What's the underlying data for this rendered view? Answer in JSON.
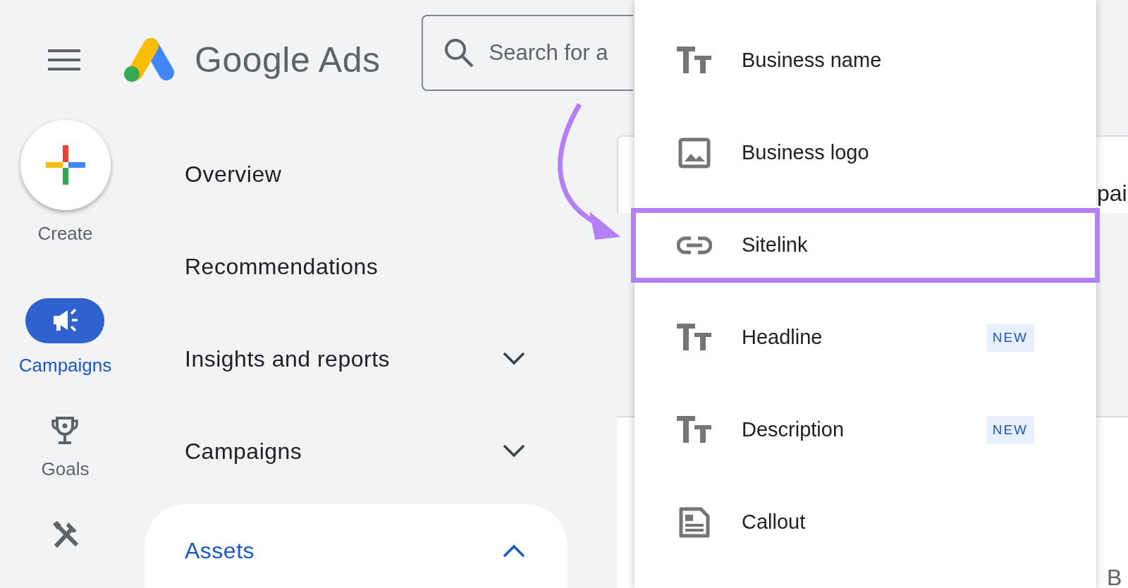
{
  "header": {
    "product_name": "Google Ads",
    "search": {
      "placeholder": "Search for a"
    }
  },
  "rail": {
    "create_label": "Create",
    "items": [
      {
        "kind": "megaphone",
        "label": "Campaigns",
        "selected": true
      },
      {
        "kind": "trophy",
        "label": "Goals",
        "selected": false
      },
      {
        "kind": "tools",
        "selected": false
      }
    ]
  },
  "nav": [
    {
      "label": "Overview",
      "selected": false
    },
    {
      "label": "Recommendations",
      "selected": false
    },
    {
      "label": "Insights and reports",
      "selected": false,
      "expanded": false
    },
    {
      "label": "Campaigns",
      "selected": false,
      "expanded": false
    },
    {
      "label": "Assets",
      "selected": true,
      "expanded": true
    }
  ],
  "background_fragments": [
    {
      "text": "pai"
    },
    {
      "text": "B"
    }
  ],
  "menu": {
    "items": [
      {
        "kind": "text",
        "label": "Business name",
        "highlighted": false
      },
      {
        "kind": "image",
        "label": "Business logo",
        "highlighted": false
      },
      {
        "kind": "link",
        "label": "Sitelink",
        "highlighted": true
      },
      {
        "kind": "text",
        "label": "Headline",
        "highlighted": false,
        "badge": "NEW"
      },
      {
        "kind": "text",
        "label": "Description",
        "highlighted": false,
        "badge": "NEW"
      },
      {
        "kind": "document",
        "label": "Callout",
        "highlighted": false
      }
    ]
  }
}
